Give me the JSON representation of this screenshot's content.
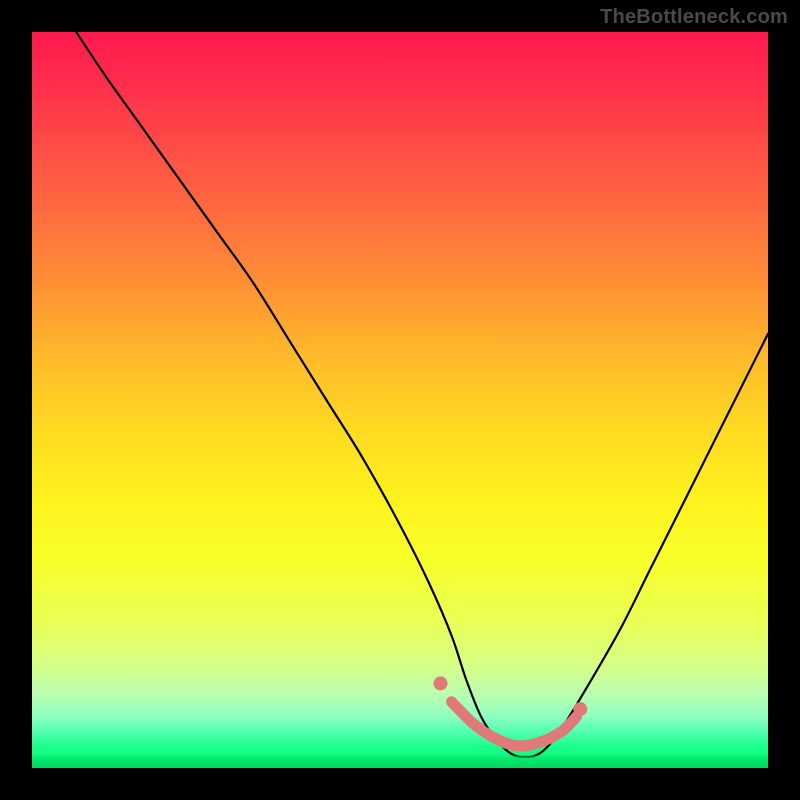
{
  "watermark": "TheBottleneck.com",
  "colors": {
    "frame": "#000000",
    "marker": "#e07a78",
    "curve": "#000000",
    "gradient_top": "#ff1a4d",
    "gradient_mid": "#ffe81e",
    "gradient_bottom": "#00e86b"
  },
  "chart_data": {
    "type": "line",
    "title": "",
    "xlabel": "",
    "ylabel": "",
    "xlim": [
      0,
      100
    ],
    "ylim": [
      0,
      100
    ],
    "grid": false,
    "legend_position": "none",
    "series": [
      {
        "name": "bottleneck-curve",
        "x": [
          6,
          10,
          15,
          20,
          25,
          30,
          35,
          40,
          45,
          50,
          54,
          57,
          59,
          61,
          63,
          65,
          67,
          69,
          71,
          73,
          76,
          80,
          84,
          88,
          92,
          96,
          100
        ],
        "y": [
          100,
          94,
          87,
          80,
          73,
          66,
          58,
          50,
          42,
          33,
          25,
          18,
          12,
          7,
          4,
          2,
          1.5,
          2,
          4,
          7,
          12,
          19,
          27,
          35,
          43,
          51,
          59
        ]
      }
    ],
    "markers": {
      "name": "optimal-range",
      "x": [
        57,
        60,
        63,
        66,
        69,
        72,
        74
      ],
      "y": [
        9,
        6,
        4,
        3,
        3.5,
        5,
        7
      ]
    },
    "annotations": []
  }
}
